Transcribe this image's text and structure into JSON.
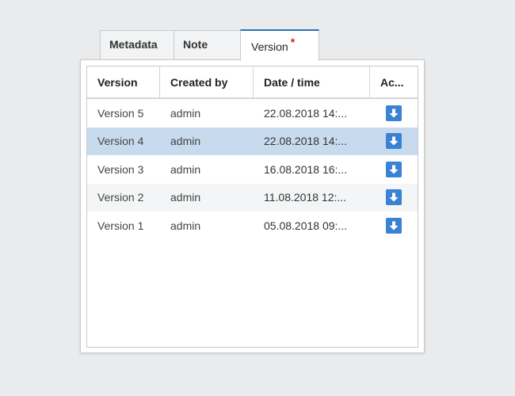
{
  "tabs": [
    {
      "label": "Metadata"
    },
    {
      "label": "Note"
    },
    {
      "label": "Version",
      "required_marker": "*"
    }
  ],
  "table": {
    "columns": [
      "Version",
      "Created by",
      "Date / time",
      "Ac..."
    ],
    "rows": [
      {
        "version": "Version 5",
        "created_by": "admin",
        "datetime": "22.08.2018 14:...",
        "action_icon": "download-icon"
      },
      {
        "version": "Version 4",
        "created_by": "admin",
        "datetime": "22.08.2018 14:...",
        "action_icon": "download-icon",
        "selected": true
      },
      {
        "version": "Version 3",
        "created_by": "admin",
        "datetime": "16.08.2018 16:...",
        "action_icon": "download-icon"
      },
      {
        "version": "Version 2",
        "created_by": "admin",
        "datetime": "11.08.2018 12:...",
        "action_icon": "download-icon"
      },
      {
        "version": "Version 1",
        "created_by": "admin",
        "datetime": "05.08.2018 09:...",
        "action_icon": "download-icon"
      }
    ]
  },
  "colors": {
    "active_tab_accent": "#2d71b6",
    "selected_row": "#c8dbee",
    "download_button": "#3a82d4",
    "required_marker": "#e02020"
  }
}
